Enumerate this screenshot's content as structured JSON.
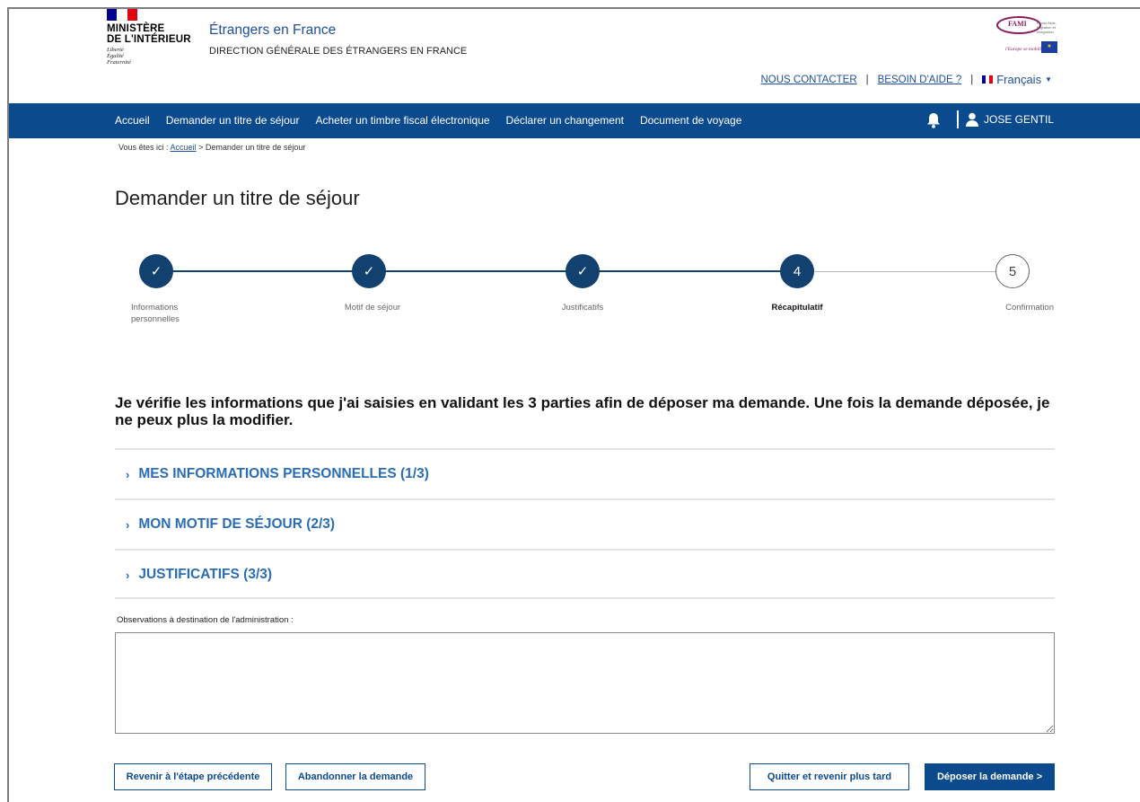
{
  "header": {
    "ministry_line1": "MINISTÈRE",
    "ministry_line2": "DE L'INTÉRIEUR",
    "motto": [
      "Liberté",
      "Égalité",
      "Fraternité"
    ],
    "site_title": "Étrangers en France",
    "site_subtitle": "DIRECTION GÉNÉRALE DES ÉTRANGERS EN FRANCE",
    "fami_logo_text": "FAMI",
    "fami_logo_small": "Fonds Asile, Migration et Intégration",
    "fami_motto": "l'Europe se mobilise",
    "links": {
      "contact": "NOUS CONTACTER",
      "help": "BESOIN D'AIDE ?",
      "separator": "|",
      "language": "Français"
    },
    "flag_colors": [
      "#000091",
      "#ffffff",
      "#e1000f"
    ]
  },
  "nav": {
    "items": [
      "Accueil",
      "Demander un titre de séjour",
      "Acheter un timbre fiscal électronique",
      "Déclarer un changement",
      "Document de voyage"
    ],
    "user_name": "JOSE GENTIL",
    "background": "#0c4a8e"
  },
  "breadcrumb": {
    "prefix": "Vous êtes ici :",
    "home": "Accueil",
    "current": "> Demander un titre de séjour"
  },
  "page_title": "Demander un titre de séjour",
  "stepper": {
    "steps": [
      {
        "label": "Informations personnelles",
        "number": "1",
        "state": "done"
      },
      {
        "label": "Motif de séjour",
        "number": "2",
        "state": "done"
      },
      {
        "label": "Justificatifs",
        "number": "3",
        "state": "done"
      },
      {
        "label": "Récapitulatif",
        "number": "4",
        "state": "active"
      },
      {
        "label": "Confirmation",
        "number": "5",
        "state": "todo"
      }
    ]
  },
  "intro": "Je vérifie les informations que j'ai saisies en validant les 3 parties afin de déposer ma demande. Une fois la demande déposée, je ne peux plus la modifier.",
  "sections": [
    {
      "title": "MES INFORMATIONS PERSONNELLES (1/3)"
    },
    {
      "title": "MON MOTIF DE SÉJOUR (2/3)"
    },
    {
      "title": "JUSTIFICATIFS (3/3)"
    }
  ],
  "observations": {
    "label": "Observations à destination de l'administration :",
    "value": ""
  },
  "buttons": {
    "back": "Revenir à l'étape précédente",
    "abandon": "Abandonner la demande",
    "later": "Quitter et revenir plus tard",
    "submit": "Déposer la demande >"
  },
  "colors": {
    "accent": "#2a6db5",
    "primary": "#0c4a8e",
    "step_done": "#12406f"
  }
}
